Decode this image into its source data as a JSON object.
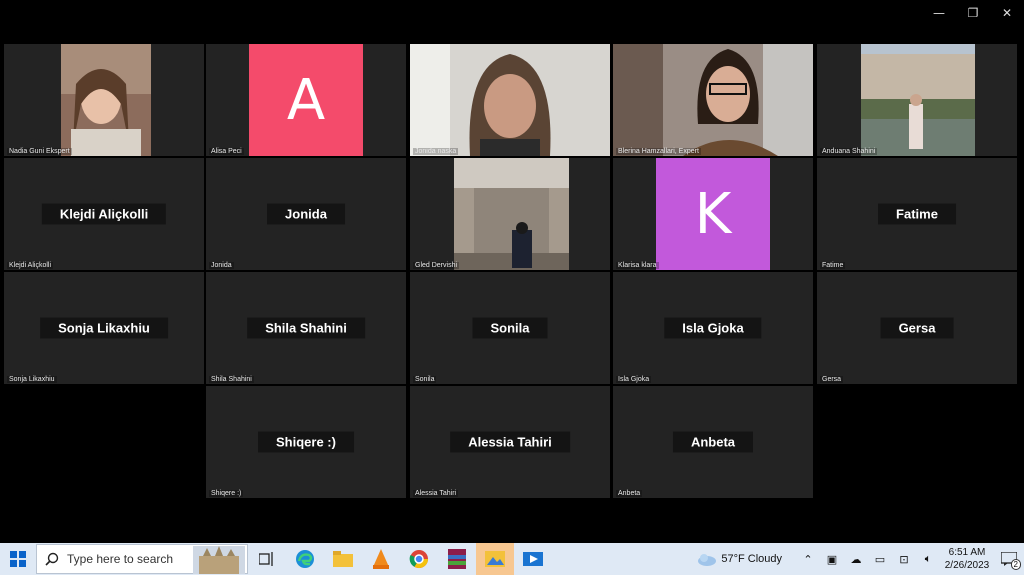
{
  "window_controls": {
    "minimize": "—",
    "restore": "❐",
    "close": "✕"
  },
  "participants": {
    "nadia": {
      "label": "Nadia Guni Ekspert"
    },
    "alisa": {
      "label": "Alisa Peci",
      "initial": "A",
      "color": "#f44b6b"
    },
    "jonida_naska": {
      "label": "Jonida naska"
    },
    "blerina": {
      "label": "Blerina Hamzallari, Expert"
    },
    "anduana": {
      "label": "Anduana Shahini"
    },
    "klejdi": {
      "name": "Klejdi Aliçkolli",
      "label": "Klejdi Aliçkolli"
    },
    "jonida": {
      "name": "Jonida",
      "label": "Jonida"
    },
    "gled": {
      "label": "Gled Dervishi"
    },
    "klarisa": {
      "label": "Klarisa klara",
      "initial": "K",
      "color": "#c259db"
    },
    "fatime": {
      "name": "Fatime",
      "label": "Fatime"
    },
    "sonja": {
      "name": "Sonja Likaxhiu",
      "label": "Sonja Likaxhiu"
    },
    "shila": {
      "name": "Shila Shahini",
      "label": "Shila Shahini"
    },
    "sonila": {
      "name": "Sonila",
      "label": "Sonila"
    },
    "isla": {
      "name": "Isla Gjoka",
      "label": "Isla Gjoka"
    },
    "gersa": {
      "name": "Gersa",
      "label": "Gersa"
    },
    "shiqere": {
      "name": "Shiqere :)",
      "label": "Shiqere :)"
    },
    "alessia": {
      "name": "Alessia Tahiri",
      "label": "Alessia Tahiri"
    },
    "anbeta": {
      "name": "Anbeta",
      "label": "Anbeta"
    }
  },
  "taskbar": {
    "search_placeholder": "Type here to search",
    "weather": "57°F  Cloudy",
    "time": "6:51 AM",
    "date": "2/26/2023",
    "notification_count": "2"
  }
}
